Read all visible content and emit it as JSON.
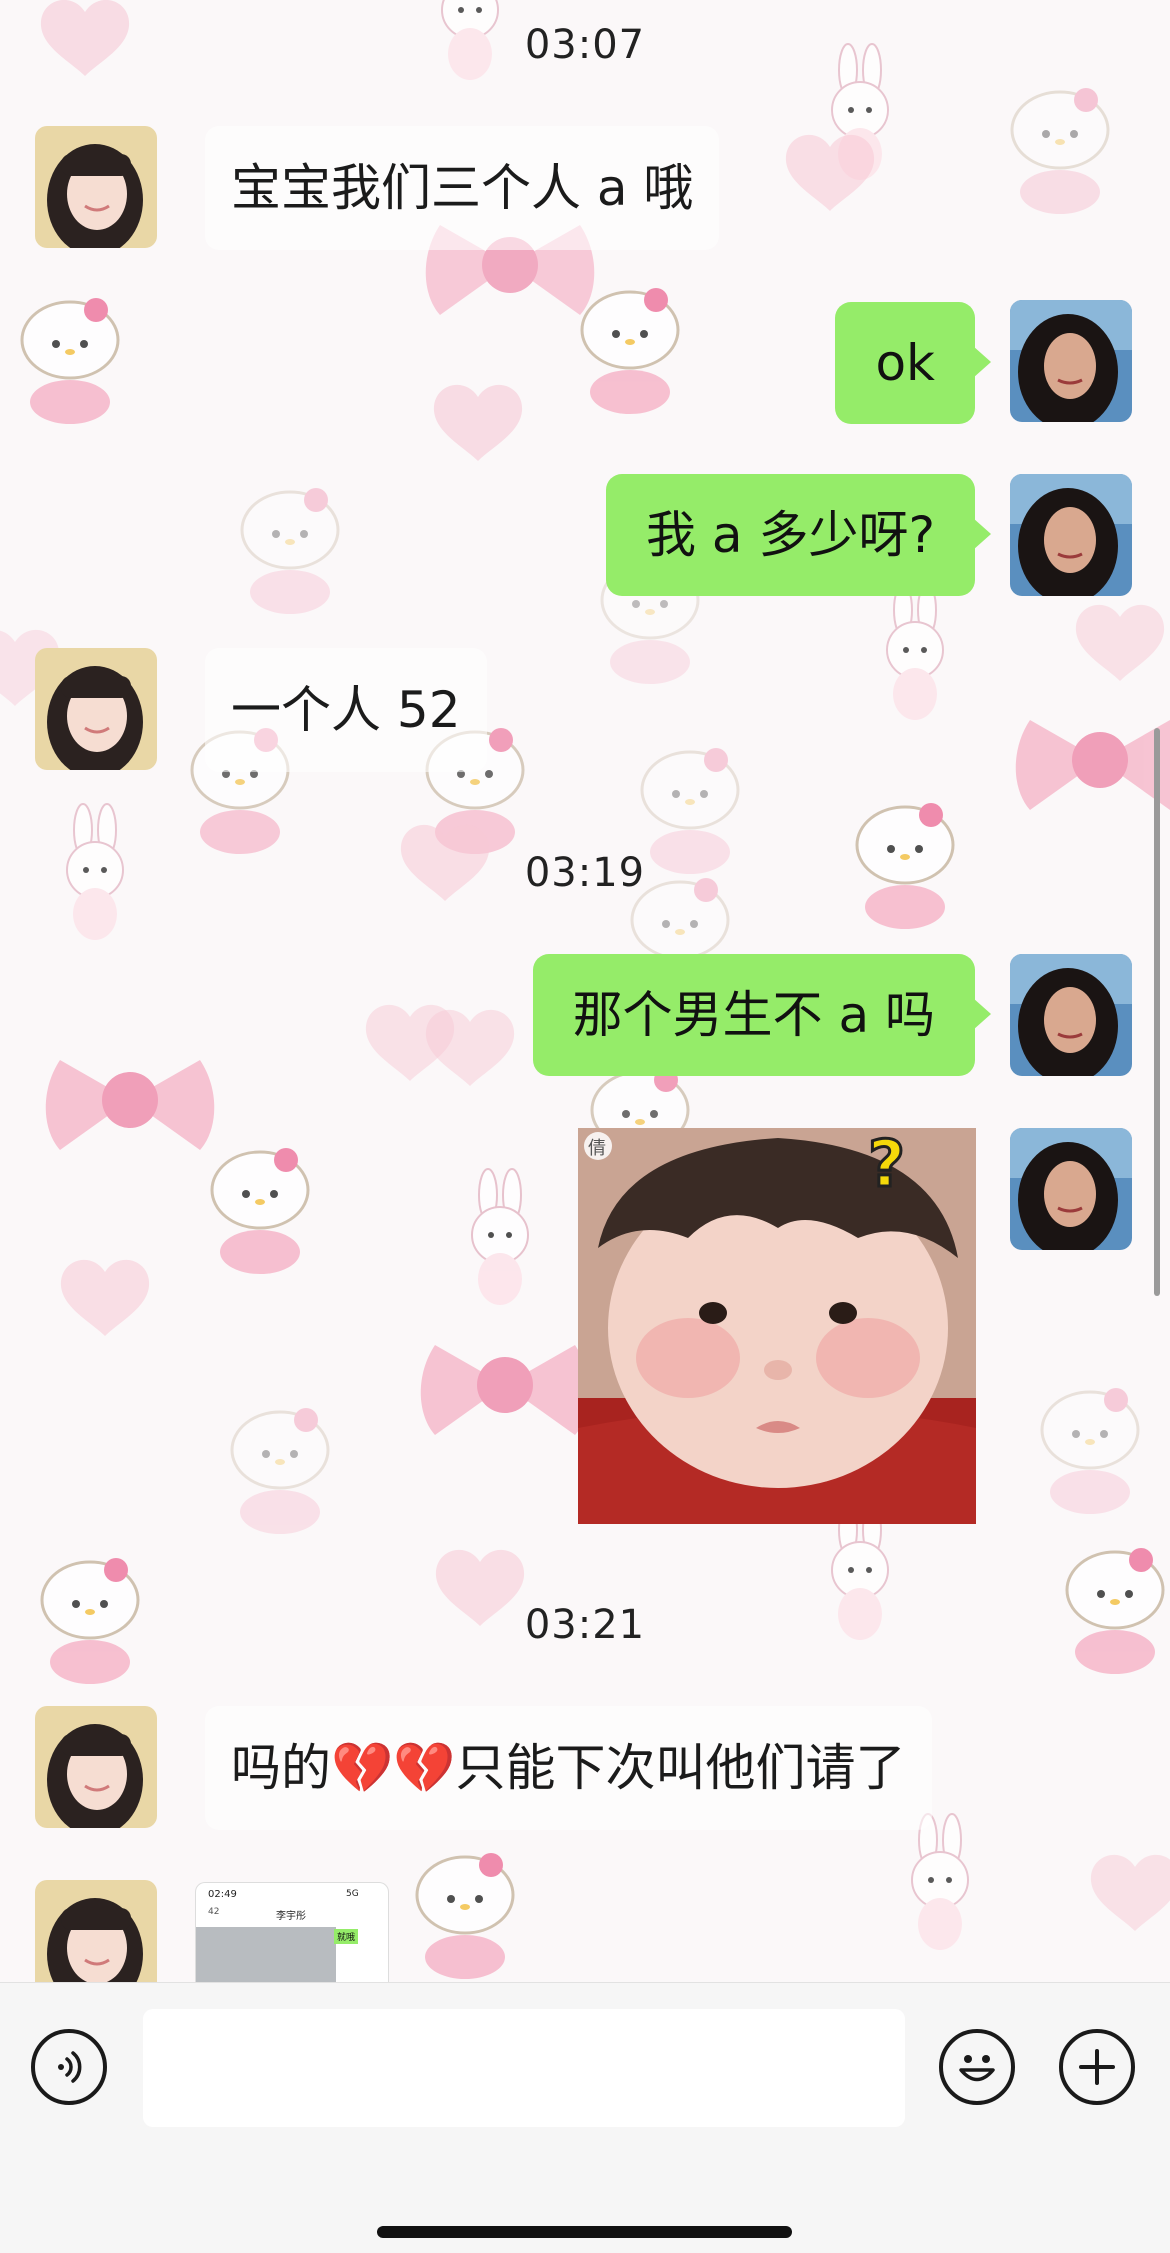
{
  "messages": [
    {
      "kind": "time",
      "text": "03:07"
    },
    {
      "kind": "in",
      "text": "宝宝我们三个人 a 哦"
    },
    {
      "kind": "out",
      "text": "ok"
    },
    {
      "kind": "out",
      "text": "我 a 多少呀?"
    },
    {
      "kind": "in",
      "text": "一个人 52"
    },
    {
      "kind": "time",
      "text": "03:19"
    },
    {
      "kind": "out",
      "text": "那个男生不 a 吗"
    },
    {
      "kind": "out-sticker",
      "badge": "倩",
      "mark": "?"
    },
    {
      "kind": "time",
      "text": "03:21"
    },
    {
      "kind": "in",
      "text": "吗的💔💔只能下次叫他们请了"
    },
    {
      "kind": "in-image",
      "status_time": "02:49",
      "signal": "5G",
      "back": "42",
      "title": "李宇彤",
      "green_label": "就哦"
    }
  ],
  "input": {
    "placeholder": ""
  },
  "icons": {
    "voice": "voice-icon",
    "emoji": "emoji-icon",
    "plus": "plus-icon"
  },
  "colors": {
    "bubble_out": "#95ec69",
    "accent_pink": "#f4aac3"
  }
}
